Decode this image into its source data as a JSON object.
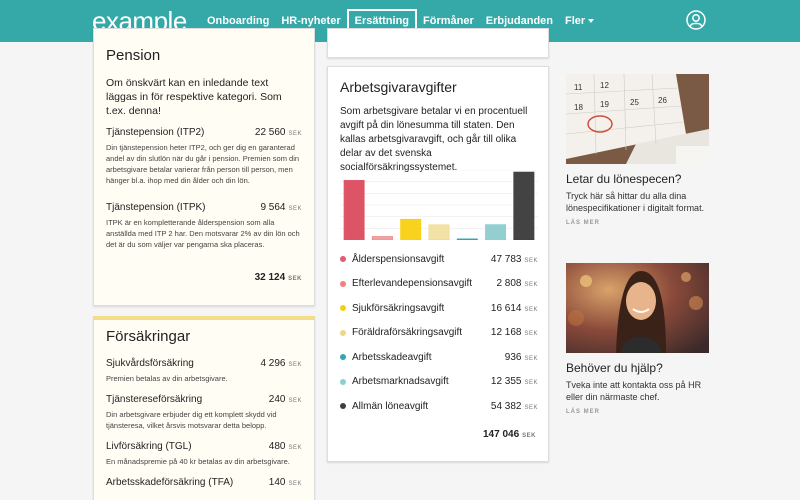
{
  "nav": {
    "logo": "example",
    "items": [
      {
        "label": "Onboarding"
      },
      {
        "label": "HR-nyheter"
      },
      {
        "label": "Ersättning"
      },
      {
        "label": "Förmåner"
      },
      {
        "label": "Erbjudanden"
      },
      {
        "label": "Fler"
      }
    ],
    "active_index": 2
  },
  "currency": "SEK",
  "pension": {
    "title": "Pension",
    "intro": "Om önskvärt kan en inledande text läggas in för respektive kategori. Som t.ex. denna!",
    "items": [
      {
        "name": "Tjänstepension (ITP2)",
        "amount": "22 560",
        "desc": "Din tjänstepension heter ITP2, och ger dig en garanterad andel av din slutlön när du går i pension. Premien som din arbetsgivare betalar varierar från person till person, men hänger bl.a. ihop med din ålder och din lön."
      },
      {
        "name": "Tjänstepension (ITPK)",
        "amount": "9 564",
        "desc": "ITPK är en kompletterande ålderspension som alla anställda med ITP 2 har. Den motsvarar 2% av din lön och det är du som väljer var pengarna ska placeras."
      }
    ],
    "total": "32 124"
  },
  "forsakring": {
    "title": "Försäkringar",
    "items": [
      {
        "name": "Sjukvårdsförsäkring",
        "amount": "4 296",
        "desc": "Premien betalas av din arbetsgivare."
      },
      {
        "name": "Tjänstereseförsäkring",
        "amount": "240",
        "desc": "Din arbetsgivare erbjuder dig ett komplett skydd vid tjänsteresa, vilket årsvis motsvarar detta belopp."
      },
      {
        "name": "Livförsäkring (TGL)",
        "amount": "480",
        "desc": "En månadspremie på 40 kr betalas av din arbetsgivare."
      },
      {
        "name": "Arbetsskadeförsäkring (TFA)",
        "amount": "140",
        "desc": ""
      }
    ]
  },
  "avgifter": {
    "title": "Arbetsgivaravgifter",
    "intro": "Som arbetsgivare betalar vi en procentuell avgift på din lönesumma till staten. Den kallas arbetsgivaravgift, och går till olika delar av det svenska socialförsäkringssystemet.",
    "total": "147 046"
  },
  "chart_data": {
    "type": "bar",
    "categories": [
      "Ålderspensionsavgift",
      "Efterlevandepensionsavgift",
      "Sjukförsäkringsavgift",
      "Föräldraförsäkringsavgift",
      "Arbetsskadeavgift",
      "Arbetsmarknadsavgift",
      "Allmän löneavgift"
    ],
    "values": [
      47783,
      2808,
      16614,
      12168,
      936,
      12355,
      54382
    ],
    "display_values": [
      "47 783",
      "2 808",
      "16 614",
      "12 168",
      "936",
      "12 355",
      "54 382"
    ],
    "colors": [
      "#e35b6e",
      "#f08080",
      "#f5cf0f",
      "#ecd889",
      "#30a8b3",
      "#8ccfcf",
      "#3f3f3f"
    ],
    "fill_colors": [
      "#dc5466",
      "#f2a0a4",
      "#f8d21c",
      "#f3e2a6",
      "#2aa5ae",
      "#93cfd0",
      "#434343"
    ],
    "ylim": [
      0,
      56000
    ],
    "grid": true
  },
  "sidebar": [
    {
      "title": "Letar du lönespecen?",
      "text": "Tryck här så hittar du alla dina lönespecifikationer i digitalt format.",
      "more": "LÄS MER",
      "image": "calendar-photo",
      "calendar_numbers": [
        "11",
        "12",
        "18",
        "19",
        "25",
        "26"
      ]
    },
    {
      "title": "Behöver du hjälp?",
      "text": "Tveka inte att kontakta oss på HR eller din närmaste chef.",
      "more": "LÄS MER",
      "image": "person-photo"
    }
  ]
}
